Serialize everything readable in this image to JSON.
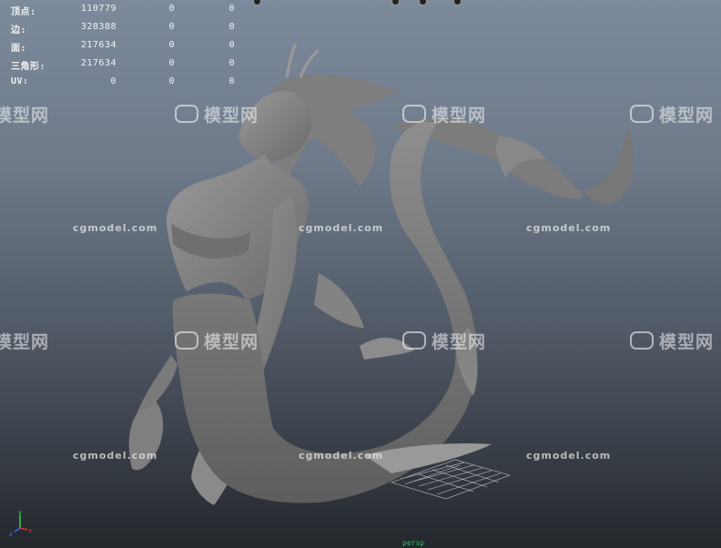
{
  "hud": {
    "rows": [
      {
        "label": "顶点:",
        "v1": "110779",
        "v2": "0",
        "v3": "0"
      },
      {
        "label": "边:",
        "v1": "328388",
        "v2": "0",
        "v3": "0"
      },
      {
        "label": "面:",
        "v1": "217634",
        "v2": "0",
        "v3": "0"
      },
      {
        "label": "三角形:",
        "v1": "217634",
        "v2": "0",
        "v3": "0"
      },
      {
        "label": "UV:",
        "v1": "0",
        "v2": "0",
        "v3": "0"
      }
    ]
  },
  "watermark": {
    "chinese": "模型网",
    "url": "cgmodel.com"
  },
  "axis": {
    "x": "x",
    "y": "y",
    "z": "z"
  },
  "bottom_label": "persp",
  "colors": {
    "hud_text": "#f2f2f2",
    "axis_x": "#e0302a",
    "axis_y": "#33d04a",
    "axis_z": "#3a6cff",
    "mesh": "#8a8a8a"
  }
}
